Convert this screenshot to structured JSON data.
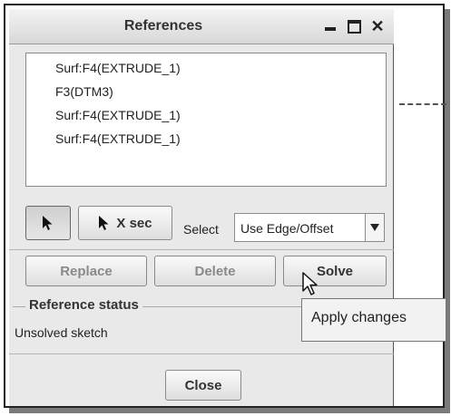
{
  "dialog": {
    "title": "References",
    "window_controls": [
      "minimize",
      "maximize",
      "close"
    ],
    "references": [
      "Surf:F4(EXTRUDE_1)",
      "F3(DTM3)",
      "Surf:F4(EXTRUDE_1)",
      "Surf:F4(EXTRUDE_1)"
    ],
    "toolbar": {
      "select_arrow_icon": "arrow-pointer",
      "xsec_label": "X sec",
      "select_label": "Select",
      "select_value": "Use Edge/Offset"
    },
    "actions": {
      "replace": "Replace",
      "delete": "Delete",
      "solve": "Solve"
    },
    "status_group": {
      "title": "Reference status",
      "value": "Unsolved sketch"
    },
    "close_label": "Close"
  },
  "tooltip": "Apply changes",
  "colors": {
    "dialog_bg": "#e9e9e9",
    "frame": "#222222"
  }
}
